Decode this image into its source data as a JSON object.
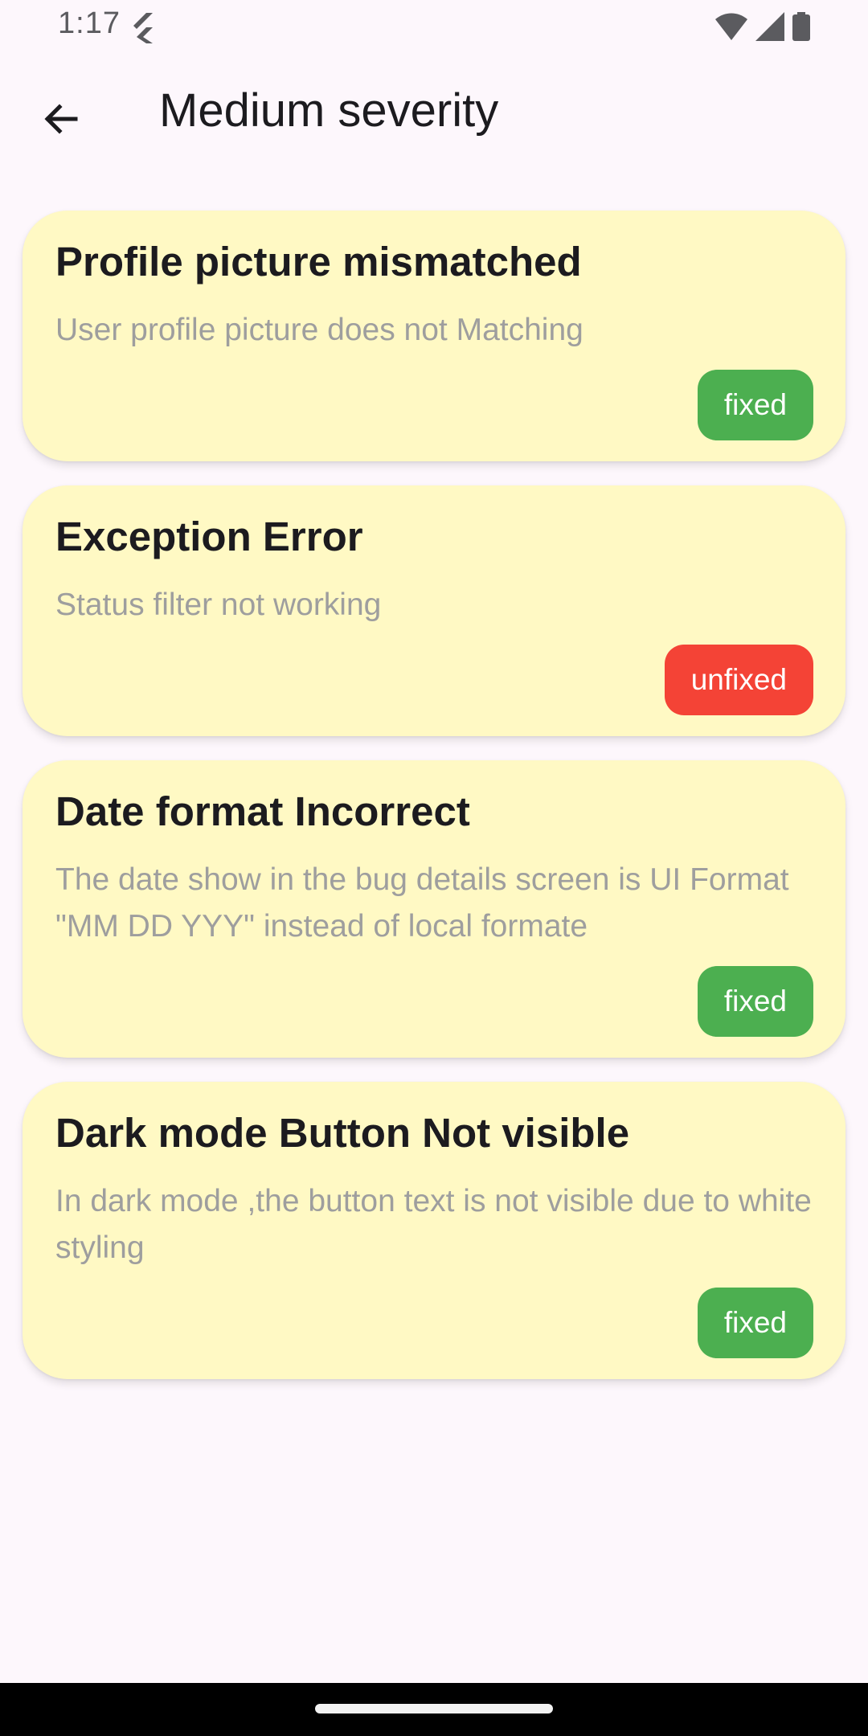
{
  "status_bar": {
    "time": "1:17",
    "icons": [
      "flutter-icon",
      "wifi-icon",
      "signal-icon",
      "battery-icon"
    ]
  },
  "app_bar": {
    "back_icon": "arrow-back-icon",
    "title": "Medium severity"
  },
  "bugs": [
    {
      "title": "Profile picture mismatched",
      "description": "User profile picture does not Matching",
      "status": "fixed"
    },
    {
      "title": "Exception Error",
      "description": "Status filter not working",
      "status": "unfixed"
    },
    {
      "title": "Date format Incorrect",
      "description": "The date show in the bug details  screen is UI Format \"MM DD YYY\" instead of local formate",
      "status": "fixed"
    },
    {
      "title": "Dark mode Button Not visible",
      "description": "In dark mode ,the button text is not visible due to white styling",
      "status": "fixed"
    }
  ],
  "colors": {
    "background": "#fdf7fc",
    "card": "#fff9c4",
    "fixed": "#4caf50",
    "unfixed": "#f44336",
    "title_text": "#1c1b1f",
    "description_text": "#9e9e9e",
    "nav_bar": "#000000"
  }
}
